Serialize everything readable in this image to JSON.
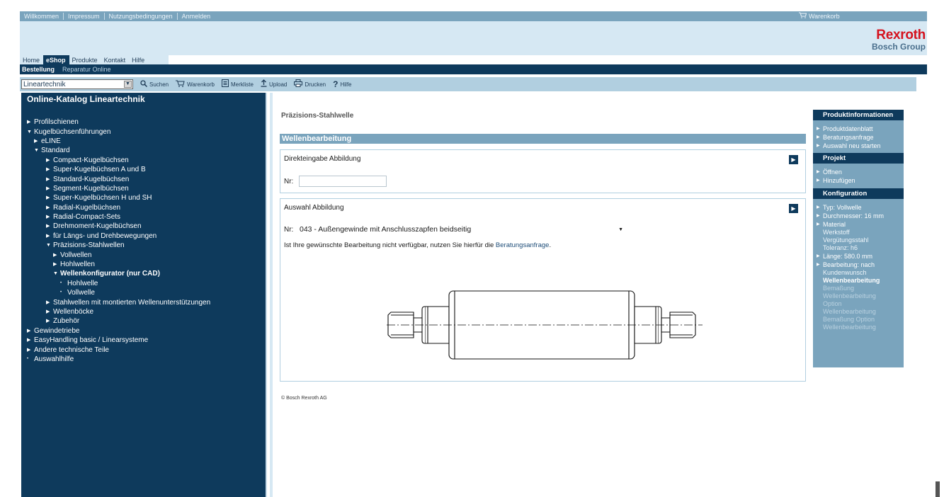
{
  "topbar": {
    "links": [
      "Willkommen",
      "Impressum",
      "Nutzungsbedingungen",
      "Anmelden"
    ],
    "cart_label": "Warenkorb"
  },
  "brand": {
    "line1": "Rexroth",
    "line2": "Bosch Group"
  },
  "nav": {
    "tabs": [
      "Home",
      "eShop",
      "Produkte",
      "Kontakt",
      "Hilfe"
    ],
    "active": "eShop",
    "subtabs": [
      "Bestellung",
      "Reparatur Online"
    ]
  },
  "toolbar": {
    "catalog_value": "Lineartechnik",
    "items": [
      {
        "icon": "search-icon",
        "label": "Suchen"
      },
      {
        "icon": "cart-icon",
        "label": "Warenkorb"
      },
      {
        "icon": "notepad-icon",
        "label": "Merkliste"
      },
      {
        "icon": "upload-icon",
        "label": "Upload"
      },
      {
        "icon": "print-icon",
        "label": "Drucken"
      },
      {
        "icon": "help-icon",
        "label": "Hilfe"
      }
    ]
  },
  "sidebar": {
    "heading": "Online-Katalog Lineartechnik",
    "tree": [
      {
        "label": "Profilschienen",
        "level": 0,
        "marker": "closed"
      },
      {
        "label": "Kugelbüchsenführungen",
        "level": 0,
        "marker": "open"
      },
      {
        "label": "eLINE",
        "level": 1,
        "marker": "closed"
      },
      {
        "label": "Standard",
        "level": 1,
        "marker": "open"
      },
      {
        "label": "Compact-Kugelbüchsen",
        "level": 2,
        "marker": "closed"
      },
      {
        "label": "Super-Kugelbüchsen A und B",
        "level": 2,
        "marker": "closed"
      },
      {
        "label": "Standard-Kugelbüchsen",
        "level": 2,
        "marker": "closed"
      },
      {
        "label": "Segment-Kugelbüchsen",
        "level": 2,
        "marker": "closed"
      },
      {
        "label": "Super-Kugelbüchsen H und SH",
        "level": 2,
        "marker": "closed"
      },
      {
        "label": "Radial-Kugelbüchsen",
        "level": 2,
        "marker": "closed"
      },
      {
        "label": "Radial-Compact-Sets",
        "level": 2,
        "marker": "closed"
      },
      {
        "label": "Drehmoment-Kugelbüchsen",
        "level": 2,
        "marker": "closed"
      },
      {
        "label": "für Längs- und Drehbewegungen",
        "level": 2,
        "marker": "closed"
      },
      {
        "label": "Präzisions-Stahlwellen",
        "level": 2,
        "marker": "open"
      },
      {
        "label": "Vollwellen",
        "level": 3,
        "marker": "closed"
      },
      {
        "label": "Hohlwellen",
        "level": 3,
        "marker": "closed"
      },
      {
        "label": "Wellenkonfigurator (nur CAD)",
        "level": 3,
        "marker": "open",
        "bold": true
      },
      {
        "label": "Hohlwelle",
        "level": 4,
        "marker": "leaf"
      },
      {
        "label": "Vollwelle",
        "level": 4,
        "marker": "leaf"
      },
      {
        "label": "Stahlwellen mit montierten Wellenunterstützungen",
        "level": 2,
        "marker": "closed"
      },
      {
        "label": "Wellenböcke",
        "level": 2,
        "marker": "closed"
      },
      {
        "label": "Zubehör",
        "level": 2,
        "marker": "closed"
      },
      {
        "label": "Gewindetriebe",
        "level": 0,
        "marker": "closed"
      },
      {
        "label": "EasyHandling basic / Linearsysteme",
        "level": 0,
        "marker": "closed"
      },
      {
        "label": "Andere technische Teile",
        "level": 0,
        "marker": "closed"
      },
      {
        "label": "Auswahlhilfe",
        "level": 0,
        "marker": "leaf"
      }
    ]
  },
  "main": {
    "page_title": "Präzisions-Stahlwelle",
    "section_title": "Wellenbearbeitung",
    "direct": {
      "title": "Direkteingabe Abbildung",
      "nr_label": "Nr:",
      "nr_value": ""
    },
    "select": {
      "title": "Auswahl Abbildung",
      "nr_label": "Nr:",
      "selected": "043 - Außengewinde mit Anschlusszapfen beidseitig",
      "hint_pre": "Ist Ihre gewünschte Bearbeitung nicht verfügbar, nutzen Sie hierfür die ",
      "hint_link": "Beratungsanfrage",
      "hint_post": "."
    },
    "copyright": "© Bosch Rexroth AG"
  },
  "rpanel": {
    "produkt_heading": "Produktinformationen",
    "produkt_items": [
      "Produktdatenblatt",
      "Beratungsanfrage",
      "Auswahl neu starten"
    ],
    "projekt_heading": "Projekt",
    "projekt_items": [
      "Öffnen",
      "Hinzufügen"
    ],
    "konfig_heading": "Konfiguration",
    "typ": "Typ: Vollwelle",
    "durchmesser": "Durchmesser: 16 mm",
    "material": "Material",
    "material_detail": [
      "Werkstoff",
      "Vergütungsstahl",
      "Toleranz: h6"
    ],
    "laenge": "Länge: 580.0 mm",
    "bearbeitung": "Bearbeitung: nach",
    "bearbeitung_detail": "Kundenwunsch",
    "bearbeitung_selected": "Wellenbearbeitung",
    "disabled_items": [
      "Bemaßung",
      "Wellenbearbeitung",
      "Option",
      "Wellenbearbeitung",
      "Bemaßung Option",
      "Wellenbearbeitung"
    ]
  }
}
